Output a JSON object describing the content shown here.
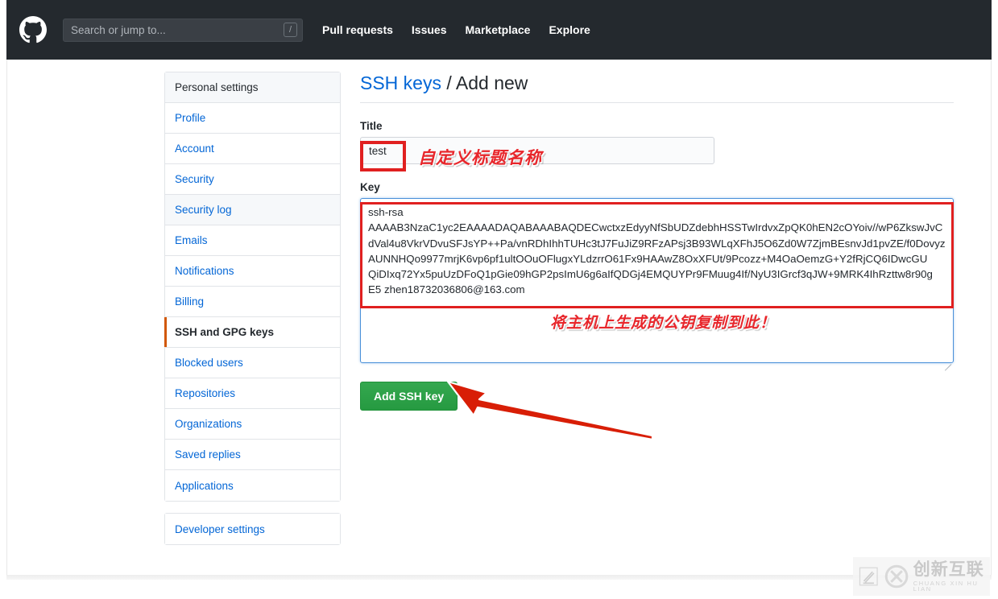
{
  "header": {
    "logo_icon": "github-octocat-icon",
    "search": {
      "placeholder": "Search or jump to...",
      "value": "",
      "shortcut_badge": "/"
    },
    "nav": [
      {
        "label": "Pull requests"
      },
      {
        "label": "Issues"
      },
      {
        "label": "Marketplace"
      },
      {
        "label": "Explore"
      }
    ],
    "background_color": "#24292e"
  },
  "sidebar": {
    "heading": "Personal settings",
    "items": [
      {
        "label": "Profile",
        "active": false
      },
      {
        "label": "Account",
        "active": false
      },
      {
        "label": "Security",
        "active": false
      },
      {
        "label": "Security log",
        "active": false
      },
      {
        "label": "Emails",
        "active": false
      },
      {
        "label": "Notifications",
        "active": false
      },
      {
        "label": "Billing",
        "active": false
      },
      {
        "label": "SSH and GPG keys",
        "active": true
      },
      {
        "label": "Blocked users",
        "active": false
      },
      {
        "label": "Repositories",
        "active": false
      },
      {
        "label": "Organizations",
        "active": false
      },
      {
        "label": "Saved replies",
        "active": false
      },
      {
        "label": "Applications",
        "active": false
      }
    ],
    "secondary": [
      {
        "label": "Developer settings"
      }
    ],
    "active_marker_color": "#d15704",
    "link_color": "#0366d6"
  },
  "main": {
    "title_link": "SSH keys",
    "title_separator": " / ",
    "title_rest": "Add new",
    "title_label": "Title",
    "title_value": "test",
    "key_label": "Key",
    "key_value": "ssh-rsa\nAAAAB3NzaC1yc2EAAAADAQABAAABAQDECwctxzEdyyNfSbUDZdebhHSSTwIrdvxZpQK0hEN2cOYoiv//wP6ZkswJvC\ndVal4u8VkrVDvuSFJsYP++Pa/vnRDhIhhTUHc3tJ7FuJiZ9RFzAPsj3B93WLqXFhJ5O6Zd0W7ZjmBEsnvJd1pvZE/f0Dovyz\nAUNNHQo9977mrjK6vp6pf1ultOOuOFlugxYLdzrrO61Fx9HAAwZ8OxXFUt/9Pcozz+M4OaOemzG+Y2fRjCQ6IDwcGU\nQiDIxq72Yx5puUzDFoQ1pGie09hGP2psImU6g6aIfQDGj4EMQUYPr9FMuug4If/NyU3IGrcf3qJW+9MRK4IhRzttw8r90g\nE5 zhen18732036806@163.com",
    "submit_label": "Add SSH key",
    "submit_color": "#2c974b"
  },
  "annotations": [
    {
      "text": "自定义标题名称",
      "color": "#e8262b",
      "target": "title-input"
    },
    {
      "text": "将主机上生成的公钥复制到此！",
      "color": "#e8262b",
      "target": "key-textarea"
    },
    {
      "text": "",
      "color": "#d81e06",
      "target": "add-ssh-key-button",
      "shape": "arrow"
    }
  ],
  "watermark": {
    "cn": "创新互联",
    "en": "CHUANG XIN HU LIAN",
    "mark_icon": "cx-logo-icon",
    "small_icon": "stamp-icon"
  }
}
